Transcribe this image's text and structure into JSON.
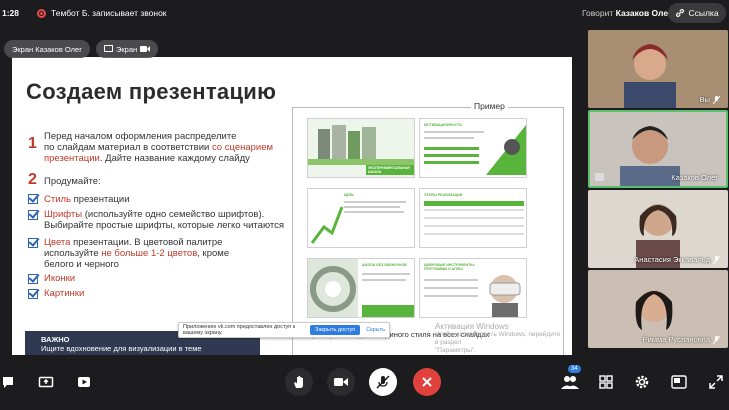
{
  "status": {
    "time": "1:28",
    "recording_text": "Тембот Б. записывает звонок",
    "speaking_prefix": "Говорит",
    "speaking_name": "Казаков Олег",
    "link_label": "Ссылка"
  },
  "screen_share": {
    "presenter_pill": "Экран Казаков Олег",
    "screen_pill": "Экран"
  },
  "slide": {
    "title": "Создаем презентацию",
    "step1_number": "1",
    "step1_line1": "Перед началом оформления распределите",
    "step1_line2_a": "по слайдам материал в соответствии ",
    "step1_line2_b": "со сценарием",
    "step1_line3_a": "презентации",
    "step1_line3_b": ". Дайте название каждому слайду",
    "step2_number": "2",
    "step2_title": "Продумайте:",
    "item1_a": "Стиль",
    "item1_b": " презентации",
    "item2_a": "Шрифты",
    "item2_b": " (используйте одно семейство шрифтов).",
    "item2_line2": "Выбирайте простые шрифты, которые легко читаются",
    "item3_a": "Цвета",
    "item3_b": " презентации. В цветовой палитре",
    "item3_line2_a": "используйте ",
    "item3_line2_b": "не больше 1-2 цветов",
    "item3_line2_c": ", кроме",
    "item3_line3": "белого и черного",
    "item4": "Иконки",
    "item5": "Картинки",
    "important_title": "ВАЖНО",
    "important_text": "Ищите вдохновение для визуализации в теме презентации",
    "example_label": "Пример",
    "example_caption": "Пример соблюдения единого стиля на всех слайдах",
    "watermark_line1": "Активация Windows",
    "watermark_line2": "Чтобы активировать Windows, перейдите в раздел",
    "watermark_line3": "\"Параметры\".",
    "thumb1_text": "ЭКСПЕРИМЕНТАЛЬНАЯ ШКОЛА",
    "thumb2_title": "МОТИВАЦИОННОСТЬ",
    "thumb3_title": "ЦЕЛЬ",
    "thumb4_title": "ЭТАПЫ РЕАЛИЗАЦИИ",
    "thumb5_title": "ШКОЛА БЕЗ ЗВОНОЧКОВ",
    "thumb6_title": "ЦИФРОВЫЕ ИНСТРУМЕНТЫ: ПРОГРАММЫ И АППЫ"
  },
  "notice": {
    "text": "Приложению vk.com предоставлен доступ к вашему экрану.",
    "stop_button": "Закрыть доступ",
    "hide_button": "Скрыть"
  },
  "participants": [
    {
      "name": "Вы",
      "muted": true
    },
    {
      "name": "Казаков Олег",
      "muted": false,
      "active": true
    },
    {
      "name": "Анастасия Эккавальд",
      "muted": true
    },
    {
      "name": "Римма Руслановна",
      "muted": true
    }
  ],
  "toolbar": {
    "participants_badge": "34"
  },
  "colors": {
    "accent_green": "#59b43c",
    "accent_red": "#c0392b",
    "end_call": "#e0413c",
    "checkbox_blue": "#2f63b0",
    "important_bg": "#2f3a52"
  }
}
